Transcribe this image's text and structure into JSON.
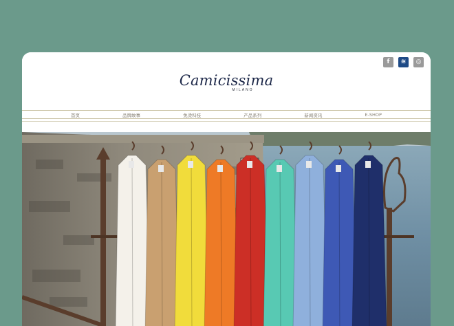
{
  "brand": {
    "name": "Camicissima",
    "sub": "MILANO"
  },
  "social": [
    {
      "label": "f",
      "icon": "facebook-icon"
    },
    {
      "label": "≋",
      "icon": "wechat-icon"
    },
    {
      "label": "◎",
      "icon": "weibo-icon"
    }
  ],
  "nav": {
    "items": [
      {
        "label": "首页"
      },
      {
        "label": "品牌故事"
      },
      {
        "label": "免烫科技"
      },
      {
        "label": "产品系列"
      },
      {
        "label": "新闻资讯"
      },
      {
        "label": "E-SHOP"
      }
    ]
  },
  "hero": {
    "shirt_colors": [
      "#f4f1ea",
      "#c9a070",
      "#f1dc3b",
      "#ee7a26",
      "#cc2f26",
      "#58c9b3",
      "#8fb0dc",
      "#3e59b5",
      "#1f2f6a"
    ]
  }
}
